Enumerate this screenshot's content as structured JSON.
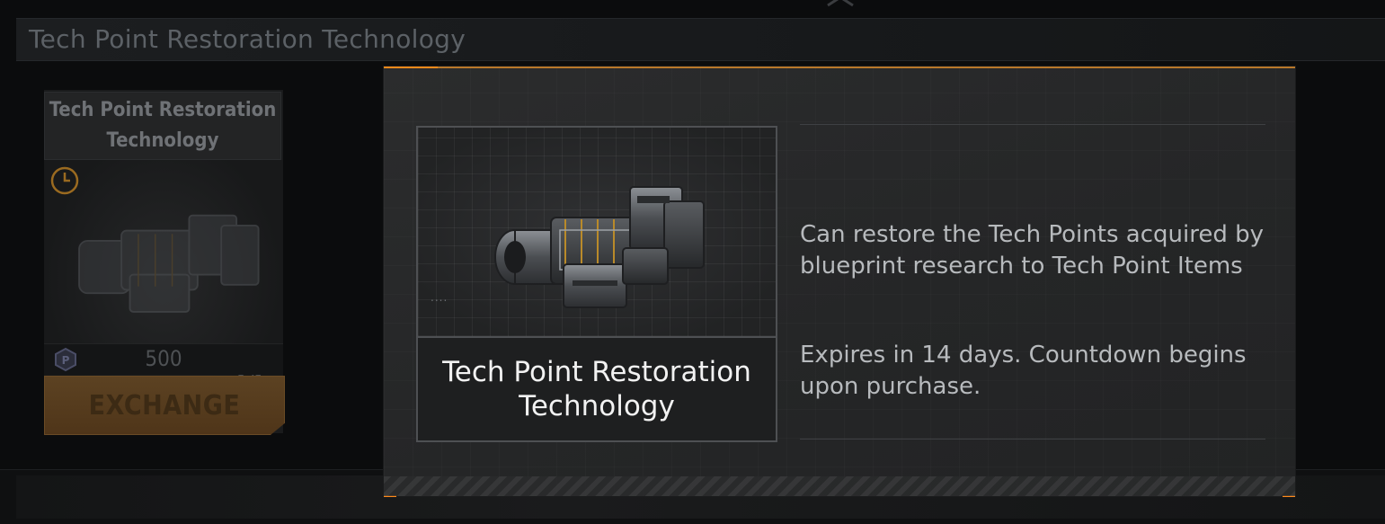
{
  "background": {
    "header_title": "Tech Point Restoration Technology",
    "card": {
      "title": "Tech Point Restoration Technology",
      "count": "1/1",
      "price": "500",
      "exchange_label": "EXCHANGE",
      "icons": [
        "clock-icon",
        "currency-icon"
      ]
    }
  },
  "modal": {
    "item_name": "Tech Point Restoration Technology",
    "description": "Can restore the Tech Points acquired by blueprint research to Tech Point Items",
    "expiry": "Expires in 14 days. Countdown begins upon purchase.",
    "image_dots": "....",
    "accent_color": "#ff8a1a"
  }
}
